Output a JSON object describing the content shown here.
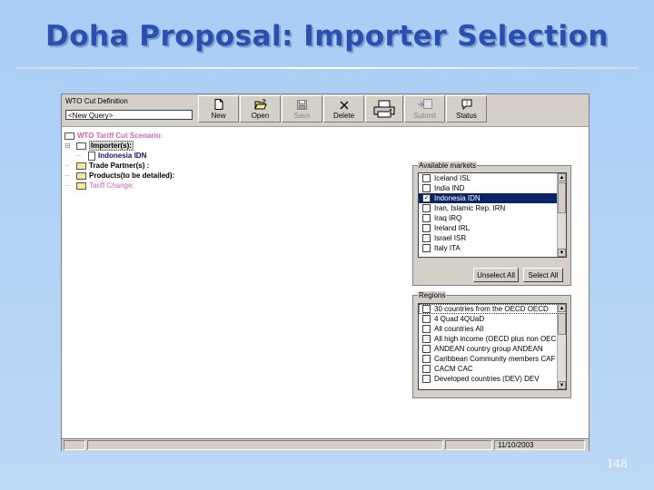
{
  "slide": {
    "title": "Doha Proposal: Importer Selection",
    "page_number": "148"
  },
  "app": {
    "definition_label": "WTO Cut Definition",
    "query_value": "<New Query>",
    "toolbar": [
      {
        "label": "New",
        "icon": "new-document-icon"
      },
      {
        "label": "Open",
        "icon": "open-folder-icon"
      },
      {
        "label": "Save",
        "icon": "save-disk-icon"
      },
      {
        "label": "Delete",
        "icon": "delete-x-icon"
      },
      {
        "label": "",
        "icon": "printer-icon"
      },
      {
        "label": "Submit",
        "icon": "submit-icon"
      },
      {
        "label": "Status",
        "icon": "status-icon"
      }
    ],
    "tree": {
      "root": "WTO Tariff Cut Scenario:",
      "importers": "Importer(s):",
      "importer_child": "Indonesia  IDN",
      "trade_partners": "Trade Partner(s) :",
      "products": "Products(to be detailed):",
      "tariff_change": "Tariff Change:"
    },
    "markets": {
      "legend": "Available markets",
      "items": [
        {
          "label": "Iceland  ISL",
          "checked": false,
          "selected": false
        },
        {
          "label": "India  IND",
          "checked": false,
          "selected": false
        },
        {
          "label": "Indonesia IDN",
          "checked": true,
          "selected": true
        },
        {
          "label": "Iran, Islamic Rep.  IRN",
          "checked": false,
          "selected": false
        },
        {
          "label": "Iraq  IRQ",
          "checked": false,
          "selected": false
        },
        {
          "label": "Ireland  IRL",
          "checked": false,
          "selected": false
        },
        {
          "label": "Israel  ISR",
          "checked": false,
          "selected": false
        },
        {
          "label": "Italy  ITA",
          "checked": false,
          "selected": false
        }
      ],
      "unselect_all": "Unselect All",
      "select_all": "Select All"
    },
    "regions": {
      "legend": "Regions",
      "items": [
        {
          "label": "30 countries from the OECD  OECD",
          "checked": false,
          "focused": true
        },
        {
          "label": "4 Quad  4QUaD",
          "checked": false,
          "focused": false
        },
        {
          "label": "All countries  All",
          "checked": false,
          "focused": false
        },
        {
          "label": "All high income (OECD plus non OEC",
          "checked": false,
          "focused": false
        },
        {
          "label": "ANDEAN country group  ANDEAN",
          "checked": false,
          "focused": false
        },
        {
          "label": "Caribbean Community members  CAF",
          "checked": false,
          "focused": false
        },
        {
          "label": "CACM  CAC",
          "checked": false,
          "focused": false
        },
        {
          "label": "Developed countries (DEV)  DEV",
          "checked": false,
          "focused": false
        }
      ]
    },
    "status": {
      "date": "11/10/2003"
    }
  }
}
